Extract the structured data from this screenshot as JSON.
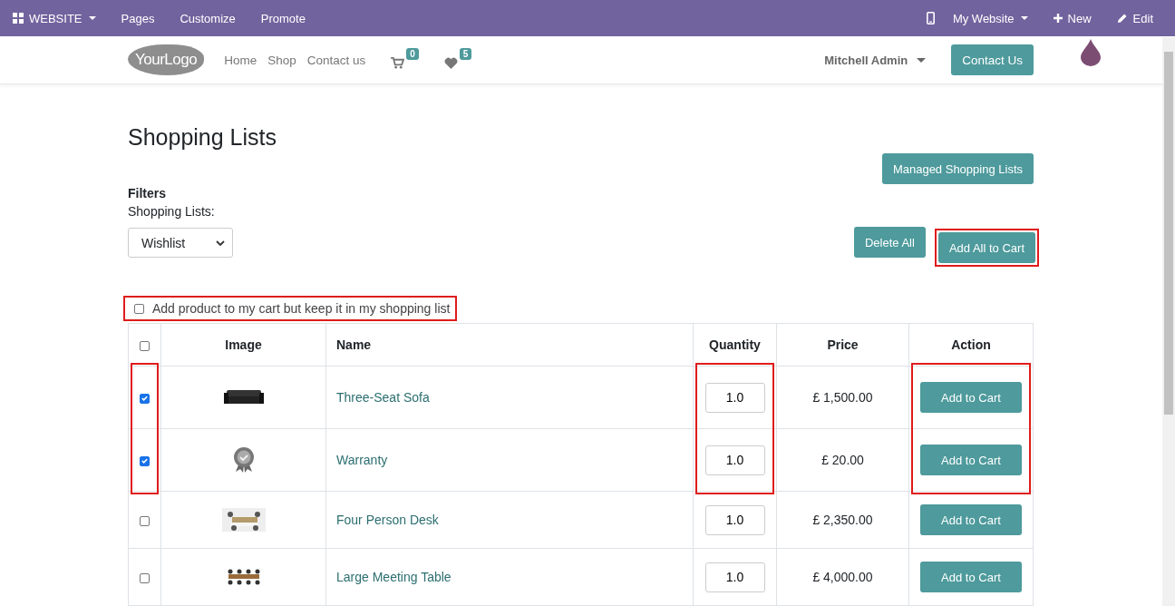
{
  "admin_bar": {
    "app_menu": "WEBSITE",
    "items": [
      "Pages",
      "Customize",
      "Promote"
    ],
    "website_menu": "My Website",
    "new_label": "New",
    "edit_label": "Edit"
  },
  "header": {
    "logo": "**Your**Logo",
    "nav": [
      "Home",
      "Shop",
      "Contact us"
    ],
    "cart_count": "0",
    "wishlist_count": "5",
    "user": "Mitchell Admin",
    "contact_button": "Contact Us"
  },
  "page": {
    "title": "Shopping Lists",
    "managed_button": "Managed Shopping Lists",
    "filters_label": "Filters",
    "list_label": "Shopping Lists:",
    "list_select": "Wishlist",
    "delete_all": "Delete All",
    "add_all": {
      "label": "Add All to Cart",
      "highlighted": true
    },
    "keep_option": {
      "label": "Add product to my cart but keep it in my shopping list",
      "checked": false,
      "highlighted": true
    }
  },
  "table": {
    "select_all_checked": false,
    "columns": [
      "Image",
      "Name",
      "Quantity",
      "Price",
      "Action"
    ],
    "rows": [
      {
        "name": "Three-Seat Sofa",
        "quantity": "1.0",
        "price": "£ 1,500.00",
        "action": "Add to Cart",
        "checked": true,
        "highlighted": true
      },
      {
        "name": "Warranty",
        "quantity": "1.0",
        "price": "£ 20.00",
        "action": "Add to Cart",
        "checked": true,
        "highlighted": true
      },
      {
        "name": "Four Person Desk",
        "quantity": "1.0",
        "price": "£ 2,350.00",
        "action": "Add to Cart",
        "checked": false,
        "highlighted": false
      },
      {
        "name": "Large Meeting Table",
        "quantity": "1.0",
        "price": "£ 4,000.00",
        "action": "Add to Cart",
        "checked": false,
        "highlighted": false
      }
    ]
  }
}
